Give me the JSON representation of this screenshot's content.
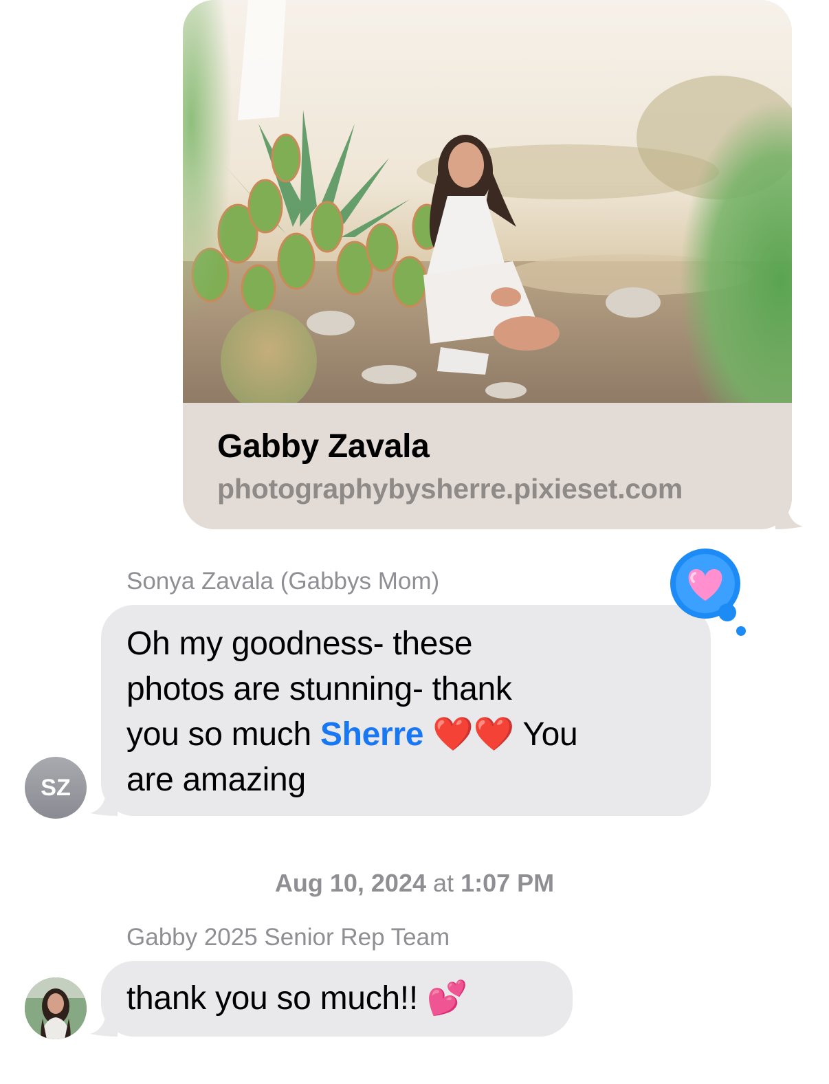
{
  "link_preview": {
    "title": "Gabby Zavala",
    "url": "photographybysherre.pixieset.com"
  },
  "message_1": {
    "sender": "Sonya Zavala (Gabbys Mom)",
    "avatar_initials": "SZ",
    "line1": "Oh my goodness- these",
    "line2": "photos are stunning- thank",
    "line3_pre": "you so much ",
    "mention": "Sherre",
    "line3_emoji": "❤️❤️",
    "line3_post": "You",
    "line4": "are amazing",
    "reaction": "heart"
  },
  "timestamp": {
    "date": "Aug 10, 2024",
    "at": "at",
    "time": "1:07 PM"
  },
  "message_2": {
    "sender": "Gabby 2025 Senior Rep Team",
    "text": "thank you so much!!",
    "emoji": "💕"
  },
  "colors": {
    "incoming_bubble": "#e9e9eb",
    "link_meta_bg": "#e3dbd6",
    "mention": "#1877f2",
    "tapback_blue": "#1d8bf5",
    "secondary_text": "#8e8e93"
  }
}
